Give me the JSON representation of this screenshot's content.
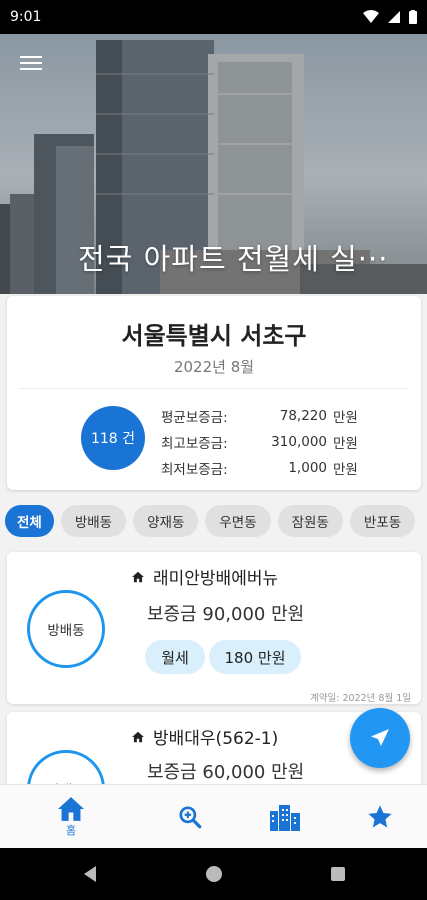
{
  "status_bar": {
    "time": "9:01"
  },
  "hero": {
    "title": "전국 아파트 전월세 실···"
  },
  "summary": {
    "region": "서울특별시 서초구",
    "period": "2022년 8월",
    "count": "118 건",
    "stats": [
      {
        "label": "평균보증금:",
        "value": "78,220",
        "unit": "만원"
      },
      {
        "label": "최고보증금:",
        "value": "310,000",
        "unit": "만원"
      },
      {
        "label": "최저보증금:",
        "value": "1,000",
        "unit": "만원"
      }
    ]
  },
  "filters": [
    "전체",
    "방배동",
    "양재동",
    "우면동",
    "잠원동",
    "반포동"
  ],
  "listings": [
    {
      "dong": "방배동",
      "name": "래미안방배에버뉴",
      "deposit": "보증금 90,000 만원",
      "type": "월세",
      "rent": "180 만원",
      "contract_date": "계약일: 2022년 8월 1일"
    },
    {
      "dong": "방배동",
      "name": "방배대우(562-1)",
      "deposit": "보증금 60,000 만원"
    }
  ],
  "bottom_nav": {
    "home_label": "홈"
  },
  "colors": {
    "primary": "#1a74d6",
    "accent": "#2196f3",
    "tag_bg": "#d9f0fc",
    "circle_border": "#1e96ee"
  }
}
